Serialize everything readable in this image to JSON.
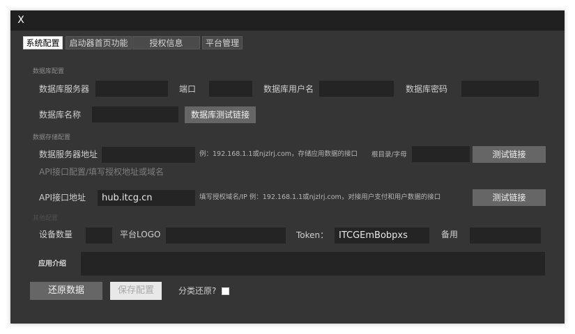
{
  "window": {
    "close_label": "X"
  },
  "tabs": [
    {
      "label": "系统配置",
      "active": true
    },
    {
      "label": "启动器首页功能",
      "active": false
    },
    {
      "label": "授权信息",
      "active": false
    },
    {
      "label": "平台管理",
      "active": false
    }
  ],
  "db": {
    "section_title": "数据库配置",
    "server_label": "数据库服务器",
    "server_value": "",
    "port_label": "端口",
    "port_value": "",
    "user_label": "数据库用户名",
    "user_value": "",
    "password_label": "数据库密码",
    "password_value": "",
    "name_label": "数据库名称",
    "name_value": "",
    "test_button": "数据库测试链接"
  },
  "storage": {
    "section_title": "数据存储配置",
    "server_label": "数据服务器地址",
    "server_value": "",
    "example_hint": "例：192.168.1.1或njzlrj.com，存储应用数据的接口",
    "root_label": "根目录/字母",
    "root_value": "",
    "test_button": "测试链接"
  },
  "api": {
    "section_title": "API接口配置/填写授权地址或域名",
    "address_label": "API接口地址",
    "address_value": "hub.itcg.cn",
    "example_hint": "填写授权域名/IP 例：192.168.1.1或njzlrj.com，对接用户支付和用户数据的接口",
    "test_button": "测试链接"
  },
  "other": {
    "section_title": "其他配置",
    "device_count_label": "设备数量",
    "device_count_value": "",
    "logo_label": "平台LOGO",
    "logo_value": "",
    "token_label": "Token：",
    "token_value": "ITCGEmBobpxs",
    "backup_label": "备用",
    "backup_value": "",
    "intro_label": "应用介绍",
    "intro_value": ""
  },
  "actions": {
    "restore_button": "还原数据",
    "save_button": "保存配置",
    "category_restore_label": "分类还原?",
    "category_restore_checked": false
  }
}
